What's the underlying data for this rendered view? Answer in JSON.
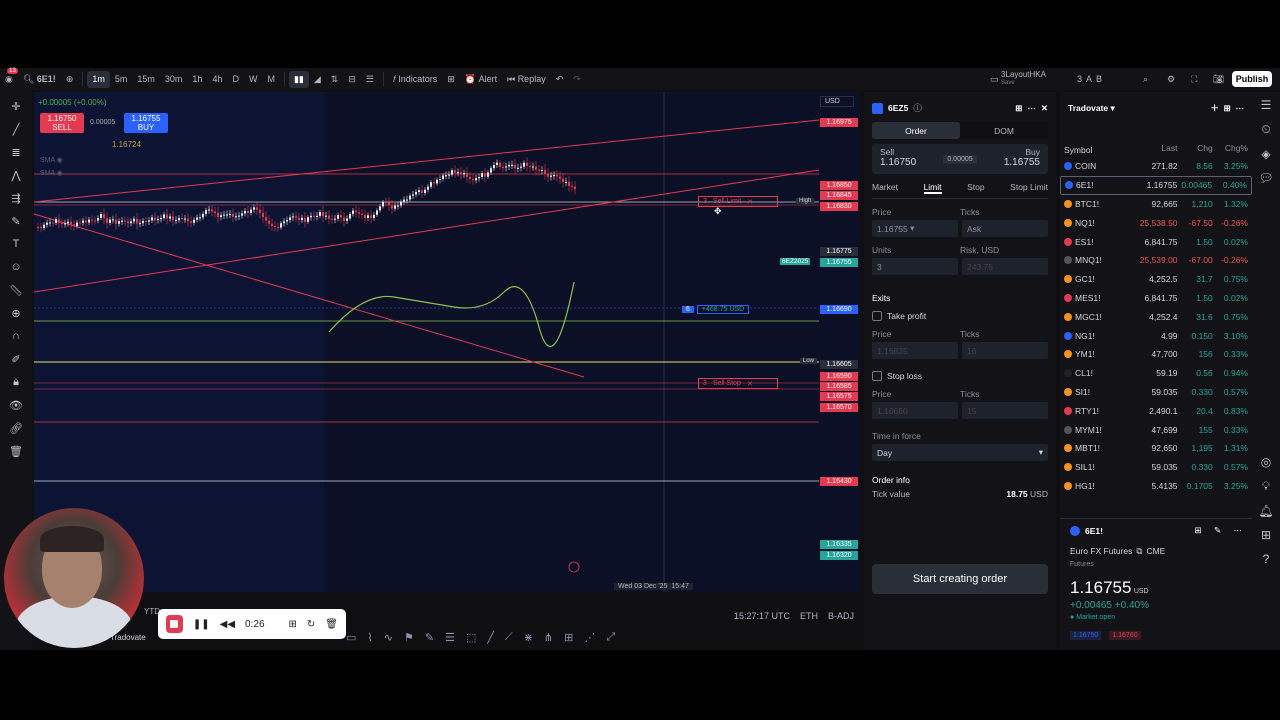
{
  "topbar": {
    "symbol": "6E1!",
    "badge": "13",
    "timeframes": [
      "1m",
      "5m",
      "15m",
      "30m",
      "1h",
      "4h",
      "D",
      "W",
      "M"
    ],
    "active_tf": "1m",
    "indicators": "Indicators",
    "alert": "Alert",
    "replay": "Replay",
    "layout": "3LayoutHKA",
    "layout_sub": "Save",
    "publish": "Publish",
    "ab": [
      "3",
      "A",
      "B"
    ]
  },
  "chart": {
    "change": "+0.00005 (+0.00%)",
    "sell_price": "1.16750",
    "sell_label": "SELL",
    "spread": "0.00005",
    "buy_price": "1.16755",
    "buy_label": "BUY",
    "last": "1.16724",
    "sma1": "SMA",
    "sma2": "SMA",
    "currency": "USD",
    "axis_labels": [
      {
        "text": "1.16975",
        "color": "#e53950",
        "y": "1.16975"
      },
      {
        "text": "1.16850",
        "color": "#e53950"
      },
      {
        "text": "1.16845",
        "color": "#e53950"
      },
      {
        "text": "1.16830",
        "color": "#e53950"
      },
      {
        "text": "1.16775",
        "color": "#2a2e39"
      },
      {
        "text": "1.16755",
        "color": "#26a69a"
      },
      {
        "text": "1.16690",
        "color": "#2962ff"
      },
      {
        "text": "1.16605",
        "color": "#2a2e39"
      },
      {
        "text": "1.16590",
        "color": "#e53950"
      },
      {
        "text": "1.16585",
        "color": "#e53950"
      },
      {
        "text": "1.16575",
        "color": "#e53950"
      },
      {
        "text": "1.16570",
        "color": "#e53950"
      },
      {
        "text": "1.16430",
        "color": "#e53950"
      },
      {
        "text": "1.16335",
        "color": "#26a69a"
      },
      {
        "text": "1.16320",
        "color": "#26a69a"
      }
    ],
    "high": "High",
    "low": "Low",
    "sell_limit": "Sell Limit",
    "sell_stop": "Sell Stop",
    "qty": "3",
    "pos_qty": "6",
    "pos_pnl": "+468.75 USD",
    "contract_tag": "6EZ2025",
    "countdown": "00:44",
    "crosshair_time": "Wed 03 Dec '25",
    "crosshair_hm": "15:47"
  },
  "bottom": {
    "clock": "15:27:17 UTC",
    "session": "ETH",
    "adj": "B-ADJ",
    "ytd": "YTD",
    "broker": "Tradovate"
  },
  "recorder": {
    "time": "0:26"
  },
  "order": {
    "symbol": "6EZ5",
    "tabs": [
      "Order",
      "DOM"
    ],
    "sell": "Sell",
    "buy": "Buy",
    "sell_price": "1.16750",
    "buy_price": "1.16755",
    "spread": "0.00005",
    "types": [
      "Market",
      "Limit",
      "Stop",
      "Stop Limit"
    ],
    "active_type": "Limit",
    "price_label": "Price",
    "ticks_label": "Ticks",
    "price_value": "1.16755",
    "ticks_value": "Ask",
    "units_label": "Units",
    "risk_label": "Risk, USD",
    "units_value": "3",
    "risk_value": "243.75",
    "exits": "Exits",
    "take_profit": "Take profit",
    "tp_price": "1.16835",
    "tp_ticks": "16",
    "stop_loss": "Stop loss",
    "sl_price": "1.16680",
    "sl_ticks": "15",
    "tif_label": "Time in force",
    "tif_value": "Day",
    "info": "Order info",
    "tick_value_label": "Tick value",
    "tick_value": "18.75",
    "tick_unit": "USD",
    "start": "Start creating order"
  },
  "watch": {
    "title": "Tradovate",
    "cols": [
      "Symbol",
      "Last",
      "Chg",
      "Chg%"
    ],
    "rows": [
      {
        "s": "COIN",
        "l": "271.82",
        "c": "8.56",
        "p": "3.25%",
        "dir": "up",
        "dot": "#2962ff"
      },
      {
        "s": "6E1!",
        "l": "1.16755",
        "c": "0.00465",
        "p": "0.40%",
        "dir": "up",
        "dot": "#2962ff",
        "sel": true
      },
      {
        "s": "BTC1!",
        "l": "92,665",
        "c": "1,210",
        "p": "1.32%",
        "dir": "up",
        "dot": "#f7931a"
      },
      {
        "s": "NQ1!",
        "l": "25,538.50",
        "c": "-67.50",
        "p": "-0.26%",
        "dir": "dn",
        "dot": "#f7931a"
      },
      {
        "s": "ES1!",
        "l": "6,841.75",
        "c": "1.50",
        "p": "0.02%",
        "dir": "up",
        "dot": "#e53950"
      },
      {
        "s": "MNQ1!",
        "l": "25,539.00",
        "c": "-67.00",
        "p": "-0.26%",
        "dir": "dn",
        "dot": "#555"
      },
      {
        "s": "GC1!",
        "l": "4,252.5",
        "c": "31.7",
        "p": "0.75%",
        "dir": "up",
        "dot": "#f7931a"
      },
      {
        "s": "MES1!",
        "l": "6,841.75",
        "c": "1.50",
        "p": "0.02%",
        "dir": "up",
        "dot": "#e53950"
      },
      {
        "s": "MGC1!",
        "l": "4,252.4",
        "c": "31.6",
        "p": "0.75%",
        "dir": "up",
        "dot": "#f7931a"
      },
      {
        "s": "NG1!",
        "l": "4.99",
        "c": "0.150",
        "p": "3.10%",
        "dir": "up",
        "dot": "#2962ff"
      },
      {
        "s": "YM1!",
        "l": "47,700",
        "c": "156",
        "p": "0.33%",
        "dir": "up",
        "dot": "#f7931a"
      },
      {
        "s": "CL1!",
        "l": "59.19",
        "c": "0.56",
        "p": "0.94%",
        "dir": "up",
        "dot": "#222"
      },
      {
        "s": "SI1!",
        "l": "59.035",
        "c": "0.330",
        "p": "0.57%",
        "dir": "up",
        "dot": "#f7931a"
      },
      {
        "s": "RTY1!",
        "l": "2,490.1",
        "c": "20.4",
        "p": "0.83%",
        "dir": "up",
        "dot": "#e53950"
      },
      {
        "s": "MYM1!",
        "l": "47,699",
        "c": "155",
        "p": "0.33%",
        "dir": "up",
        "dot": "#555"
      },
      {
        "s": "MBT1!",
        "l": "92,650",
        "c": "1,195",
        "p": "1.31%",
        "dir": "up",
        "dot": "#f7931a"
      },
      {
        "s": "SIL1!",
        "l": "59.035",
        "c": "0.330",
        "p": "0.57%",
        "dir": "up",
        "dot": "#f7931a"
      },
      {
        "s": "HG1!",
        "l": "5.4135",
        "c": "0.1705",
        "p": "3.25%",
        "dir": "up",
        "dot": "#f7931a"
      }
    ],
    "detail": {
      "symbol": "6E1!",
      "name": "Euro FX Futures",
      "exchange": "CME",
      "type": "Futures",
      "price": "1.16755",
      "unit": "USD",
      "change": "+0.00465 +0.40%",
      "status": "Market open",
      "bid_tag": "1.16750",
      "ask_tag": "1.16760"
    }
  }
}
